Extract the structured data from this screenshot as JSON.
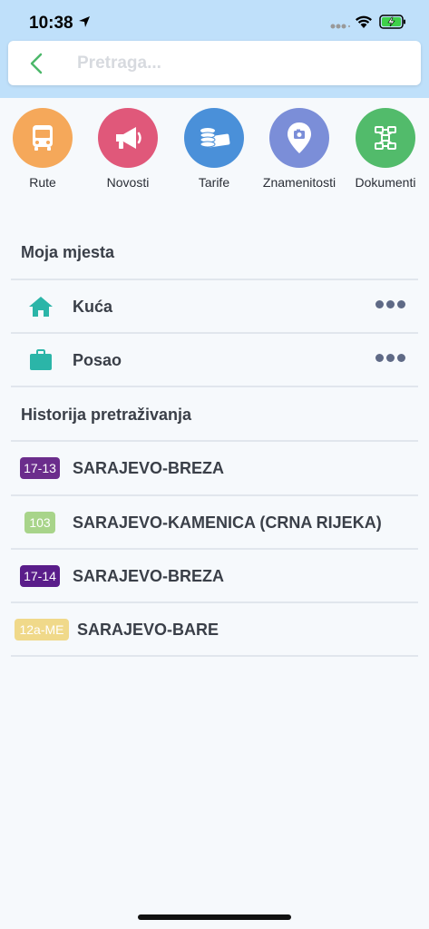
{
  "status": {
    "time": "10:38"
  },
  "search": {
    "placeholder": "Pretraga..."
  },
  "categories": [
    {
      "label": "Rute",
      "icon": "bus-icon",
      "color": "#f5a85a"
    },
    {
      "label": "Novosti",
      "icon": "megaphone-icon",
      "color": "#e0587a"
    },
    {
      "label": "Tarife",
      "icon": "money-icon",
      "color": "#4a90d9"
    },
    {
      "label": "Znamenitosti",
      "icon": "landmark-pin-icon",
      "color": "#7b8ed8"
    },
    {
      "label": "Dokumenti",
      "icon": "network-document-icon",
      "color": "#52bb6b"
    }
  ],
  "my_places": {
    "title": "Moja mjesta",
    "items": [
      {
        "label": "Kuća",
        "icon": "home-icon"
      },
      {
        "label": "Posao",
        "icon": "briefcase-icon"
      }
    ]
  },
  "history": {
    "title": "Historija pretraživanja",
    "items": [
      {
        "badge": "17-13",
        "badge_color": "#6b2d8c",
        "label": "SARAJEVO-BREZA"
      },
      {
        "badge": "103",
        "badge_color": "#a8d48a",
        "label": "SARAJEVO-KAMENICA (CRNA RIJEKA)"
      },
      {
        "badge": "17-14",
        "badge_color": "#5a1d8a",
        "label": "SARAJEVO-BREZA"
      },
      {
        "badge": "12a-ME",
        "badge_color": "#f0d98a",
        "label": "SARAJEVO-BARE"
      }
    ]
  },
  "colors": {
    "accent_green": "#4cb86a",
    "teal_icon": "#2bb5a8"
  }
}
